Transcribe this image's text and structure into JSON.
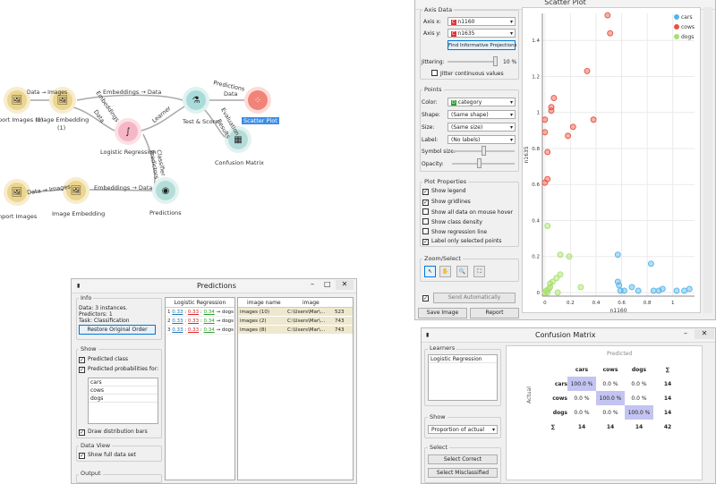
{
  "canvas": {
    "nodes": {
      "import1": "port Images (1)",
      "embed1": "Image Embedding",
      "embed1_idx": "(1)",
      "logreg": "Logistic Regression",
      "testscore": "Test & Score",
      "scatter": "Scatter Plot",
      "confusion": "Confusion Matrix",
      "import2": "nport Images",
      "embed2": "Image Embedding",
      "predictions": "Predictions"
    },
    "edges": {
      "e1": "Data → Images",
      "e2": "Embeddings → Data",
      "e3": "Embeddings",
      "e3b": "Data",
      "e4": "Learner",
      "e5": "Predictions",
      "e5b": "Data",
      "e6": "Evaluation",
      "e6b": "Results",
      "e7": "Classifier",
      "e7b": "Predictors",
      "e8": "Data → Images",
      "e9": "Embeddings → Data"
    }
  },
  "scatter": {
    "title": "Scatter Plot",
    "axis_data_title": "Axis Data",
    "axis_x_label": "Axis x:",
    "axis_x_value": "n1160",
    "axis_y_label": "Axis y:",
    "axis_y_value": "n1635",
    "find_btn": "Find Informative Projections",
    "jitter_label": "Jittering:",
    "jitter_value": "10 %",
    "jitter_cont": "Jitter continuous values",
    "points_title": "Points",
    "color_label": "Color:",
    "color_value": "category",
    "shape_label": "Shape:",
    "shape_value": "(Same shape)",
    "size_label": "Size:",
    "size_value": "(Same size)",
    "label_label": "Label:",
    "label_value": "(No labels)",
    "symbol_size": "Symbol size:",
    "opacity": "Opacity:",
    "props_title": "Plot Properties",
    "p1": "Show legend",
    "p2": "Show gridlines",
    "p3": "Show all data on mouse hover",
    "p4": "Show class density",
    "p5": "Show regression line",
    "p6": "Label only selected points",
    "zoom_title": "Zoom/Select",
    "send_auto": "Send Automatically",
    "save_image": "Save Image",
    "report": "Report"
  },
  "chart_data": {
    "type": "scatter",
    "xlabel": "n1160",
    "ylabel": "n1635",
    "xlim": [
      -0.02,
      1.17
    ],
    "ylim": [
      -0.02,
      1.55
    ],
    "xticks": [
      "0",
      "0.2",
      "0.4",
      "0.6",
      "0.8",
      "1"
    ],
    "yticks": [
      "0",
      "0.2",
      "0.4",
      "0.6",
      "0.8",
      "1",
      "1.2",
      "1.4"
    ],
    "legend": "top-right",
    "series": [
      {
        "name": "cars",
        "color": "#52b4e8",
        "points": [
          [
            0.57,
            0.21
          ],
          [
            0.57,
            0.06
          ],
          [
            0.58,
            0.04
          ],
          [
            0.62,
            0.01
          ],
          [
            0.68,
            0.03
          ],
          [
            0.73,
            0.01
          ],
          [
            0.83,
            0.16
          ],
          [
            0.85,
            0.01
          ],
          [
            0.89,
            0.01
          ],
          [
            0.92,
            0.02
          ],
          [
            1.03,
            0.01
          ],
          [
            1.09,
            0.01
          ],
          [
            1.13,
            0.02
          ],
          [
            0.59,
            0.01
          ]
        ]
      },
      {
        "name": "cows",
        "color": "#e8523f",
        "points": [
          [
            0.49,
            1.54
          ],
          [
            0.51,
            1.44
          ],
          [
            0.33,
            1.23
          ],
          [
            0.38,
            0.96
          ],
          [
            0.07,
            1.08
          ],
          [
            0.05,
            1.03
          ],
          [
            0.05,
            1.01
          ],
          [
            0.22,
            0.92
          ],
          [
            0.18,
            0.87
          ],
          [
            0.0,
            0.96
          ],
          [
            0.0,
            0.89
          ],
          [
            0.02,
            0.78
          ],
          [
            0.0,
            0.61
          ],
          [
            0.02,
            0.63
          ]
        ]
      },
      {
        "name": "dogs",
        "color": "#a6e06a",
        "points": [
          [
            0.02,
            0.37
          ],
          [
            0.12,
            0.21
          ],
          [
            0.19,
            0.2
          ],
          [
            0.12,
            0.1
          ],
          [
            0.09,
            0.08
          ],
          [
            0.06,
            0.06
          ],
          [
            0.04,
            0.03
          ],
          [
            0.03,
            0.02
          ],
          [
            0.01,
            0.01
          ],
          [
            0.02,
            0.0
          ],
          [
            0.04,
            0.05
          ],
          [
            0.1,
            0.0
          ],
          [
            0.28,
            0.03
          ],
          [
            0.0,
            0.0
          ]
        ]
      }
    ]
  },
  "predictions": {
    "title": "Predictions",
    "info_title": "Info",
    "info1": "Data: 3 instances.",
    "info2": "Predictors: 1",
    "info3": "Task: Classification",
    "restore_btn": "Restore Original Order",
    "show_title": "Show",
    "pred_class": "Predicted class",
    "pred_probs": "Predicted probabilities for:",
    "classes": [
      "cars",
      "cows",
      "dogs"
    ],
    "dist_bars": "Draw distribution bars",
    "dataview_title": "Data View",
    "full_data": "Show full data set",
    "output_title": "Output",
    "col_lr": "Logistic Regression",
    "col_name": "image name",
    "col_image": "image",
    "rows": [
      {
        "idx": "1",
        "p1": "0.33",
        "p2": "0.33",
        "p3": "0.34",
        "cls": "dogs",
        "name": "images (10)",
        "path": "C:\\Users\\Mar\\...",
        "num": "523"
      },
      {
        "idx": "2",
        "p1": "0.33",
        "p2": "0.33",
        "p3": "0.34",
        "cls": "dogs",
        "name": "images (2)",
        "path": "C:\\Users\\Mar\\...",
        "num": "743"
      },
      {
        "idx": "3",
        "p1": "0.33",
        "p2": "0.33",
        "p3": "0.34",
        "cls": "dogs",
        "name": "images (8)",
        "path": "C:\\Users\\Mar\\...",
        "num": "743"
      }
    ]
  },
  "confusion": {
    "title": "Confusion Matrix",
    "learners_title": "Learners",
    "learner": "Logistic Regression",
    "show_title": "Show",
    "show_value": "Proportion of actual",
    "select_title": "Select",
    "select_correct": "Select Correct",
    "select_mis": "Select Misclassified",
    "predicted": "Predicted",
    "actual": "Actual",
    "cols": [
      "cars",
      "cows",
      "dogs",
      "∑"
    ],
    "rows": [
      {
        "label": "cars",
        "cells": [
          "100.0 %",
          "0.0 %",
          "0.0 %"
        ],
        "sum": "14"
      },
      {
        "label": "cows",
        "cells": [
          "0.0 %",
          "100.0 %",
          "0.0 %"
        ],
        "sum": "14"
      },
      {
        "label": "dogs",
        "cells": [
          "0.0 %",
          "0.0 %",
          "100.0 %"
        ],
        "sum": "14"
      }
    ],
    "total_label": "∑",
    "totals": [
      "14",
      "14",
      "14",
      "42"
    ]
  }
}
